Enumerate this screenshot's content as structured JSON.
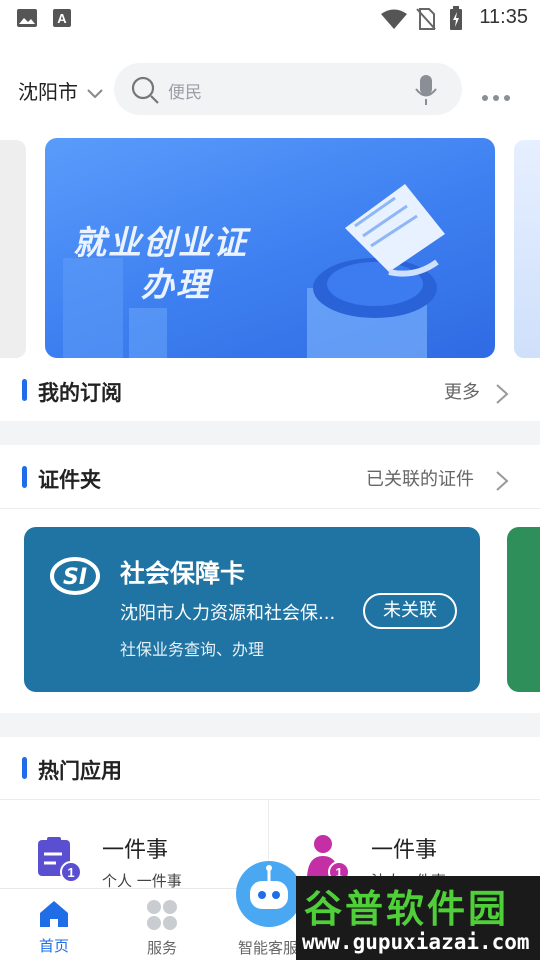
{
  "status_bar": {
    "time": "11:35"
  },
  "header": {
    "city": "沈阳市",
    "search_placeholder": "便民"
  },
  "banner": {
    "line1": "就业创业证",
    "line2": "办理"
  },
  "subscription": {
    "title": "我的订阅",
    "more": "更多"
  },
  "wallet": {
    "title": "证件夹",
    "linked": "已关联的证件"
  },
  "card": {
    "title": "社会保障卡",
    "org": "沈阳市人力资源和社会保...",
    "button": "未关联",
    "desc": "社保业务查询、办理",
    "logo_text": "SI",
    "color": "#1f74a3"
  },
  "hot_apps": {
    "title": "热门应用",
    "items": [
      {
        "title": "一件事",
        "sub": "个人 一件事",
        "badge": "1",
        "icon": "clipboard-icon"
      },
      {
        "title": "一件事",
        "sub": "法人一件事",
        "badge": "1",
        "icon": "person-icon"
      }
    ]
  },
  "tabbar": {
    "items": [
      {
        "label": "首页",
        "icon": "home-icon",
        "active": true
      },
      {
        "label": "服务",
        "icon": "grid-icon",
        "active": false
      },
      {
        "label": "智能客服",
        "icon": "robot-icon",
        "active": false
      }
    ]
  },
  "watermark": {
    "top": "谷普软件园",
    "bottom": "www.gupuxiazai.com"
  },
  "colors": {
    "accent": "#1f6ee8",
    "card": "#1f74a3",
    "banner": "#3d7ff0"
  }
}
